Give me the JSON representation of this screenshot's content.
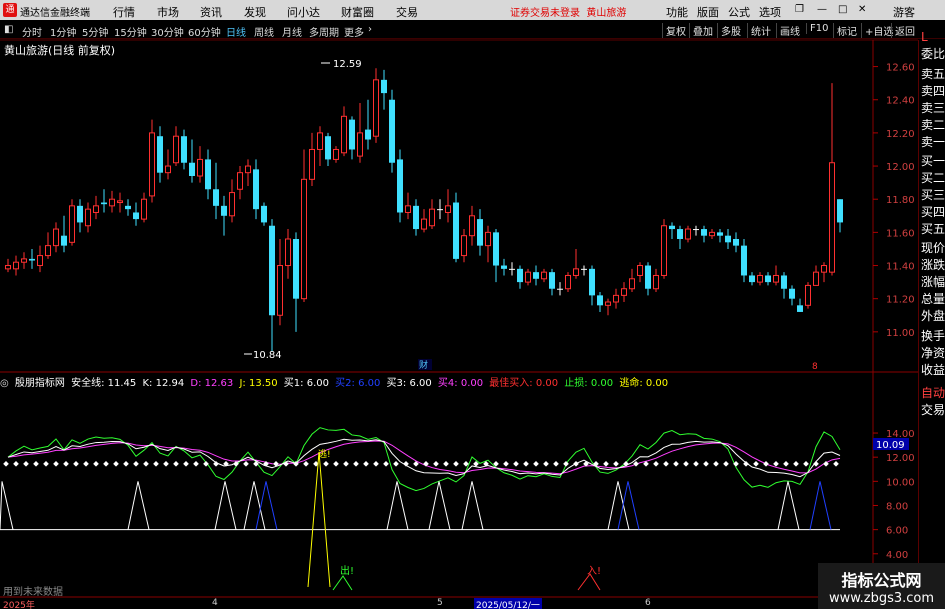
{
  "app": {
    "title": "通达信金融终端",
    "login_notice": "证券交易未登录",
    "login_stock": "黄山旅游",
    "guest": "游客"
  },
  "menu": [
    "行情",
    "市场",
    "资讯",
    "发现",
    "问小达",
    "财富圈",
    "交易"
  ],
  "right_menu": [
    "功能",
    "版面",
    "公式",
    "选项"
  ],
  "periods": [
    "分时",
    "1分钟",
    "5分钟",
    "15分钟",
    "30分钟",
    "60分钟",
    "日线",
    "周线",
    "月线",
    "多周期",
    "更多"
  ],
  "active_period": "日线",
  "toolbar_right": [
    "复权",
    "叠加",
    "多股",
    "统计",
    "画线",
    "F10",
    "标记",
    "+自选",
    "返回"
  ],
  "stock_label": "黄山旅游(日线 前复权)",
  "right_panel": [
    "L",
    "委比",
    "卖五",
    "卖四",
    "卖三",
    "卖二",
    "卖一",
    "买一",
    "买二",
    "买三",
    "买四",
    "买五",
    "现价",
    "涨跌",
    "涨幅",
    "总量",
    "外盘",
    "换手",
    "净资",
    "收益",
    "自动",
    "交易"
  ],
  "price_axis": [
    "12.60",
    "12.40",
    "12.20",
    "12.00",
    "11.80",
    "11.60",
    "11.40",
    "11.20",
    "11.00"
  ],
  "ind_axis": [
    "14.00",
    "12.00",
    "10.00",
    "8.00",
    "6.00",
    "4.00",
    "2.00"
  ],
  "ind_current": "10.09",
  "annotations": {
    "high": "12.59",
    "low": "10.84",
    "cai": "财",
    "num8": "8",
    "tao": "逃!",
    "chu": "出!",
    "ru": "入!"
  },
  "indicator": {
    "name": "殷朋指标网",
    "items": [
      {
        "label": "安全线: 11.45",
        "color": "#ffffff"
      },
      {
        "label": "K: 12.94",
        "color": "#ffffff"
      },
      {
        "label": "D: 12.63",
        "color": "#ff40ff"
      },
      {
        "label": "J: 13.50",
        "color": "#ffff00"
      },
      {
        "label": "买1: 6.00",
        "color": "#ffffff"
      },
      {
        "label": "买2: 6.00",
        "color": "#2040ff"
      },
      {
        "label": "买3: 6.00",
        "color": "#ffffff"
      },
      {
        "label": "买4: 0.00",
        "color": "#ff40ff"
      },
      {
        "label": "最佳买入: 0.00",
        "color": "#ff3030"
      },
      {
        "label": "止损: 0.00",
        "color": "#30ff30"
      },
      {
        "label": "逃命: 0.00",
        "color": "#ffff00"
      }
    ]
  },
  "dates": [
    "2025年",
    "4",
    "5",
    "2025/05/12/一",
    "6"
  ],
  "footer": "用到未来数据",
  "watermark": {
    "line1": "指标公式网",
    "line2": "www.zbgs3.com"
  },
  "chart_data": {
    "type": "candlestick",
    "title": "黄山旅游(日线 前复权)",
    "ylim": [
      10.8,
      12.7
    ],
    "candles": [
      [
        11.38,
        11.4,
        11.36,
        11.44
      ],
      [
        11.38,
        11.42,
        11.34,
        11.46
      ],
      [
        11.42,
        11.44,
        11.38,
        11.48
      ],
      [
        11.44,
        11.43,
        11.38,
        11.5
      ],
      [
        11.4,
        11.46,
        11.36,
        11.52
      ],
      [
        11.46,
        11.52,
        11.44,
        11.6
      ],
      [
        11.52,
        11.62,
        11.48,
        11.66
      ],
      [
        11.58,
        11.52,
        11.48,
        11.7
      ],
      [
        11.54,
        11.76,
        11.52,
        11.8
      ],
      [
        11.76,
        11.66,
        11.6,
        11.8
      ],
      [
        11.64,
        11.74,
        11.6,
        11.78
      ],
      [
        11.72,
        11.76,
        11.68,
        11.82
      ],
      [
        11.78,
        11.77,
        11.72,
        11.86
      ],
      [
        11.76,
        11.8,
        11.72,
        11.85
      ],
      [
        11.78,
        11.79,
        11.72,
        11.84
      ],
      [
        11.76,
        11.74,
        11.7,
        11.8
      ],
      [
        11.72,
        11.68,
        11.64,
        11.78
      ],
      [
        11.68,
        11.8,
        11.66,
        11.84
      ],
      [
        11.82,
        12.2,
        11.78,
        12.28
      ],
      [
        12.18,
        11.96,
        11.9,
        12.24
      ],
      [
        11.96,
        12.0,
        11.92,
        12.1
      ],
      [
        12.02,
        12.18,
        12.0,
        12.24
      ],
      [
        12.18,
        12.02,
        11.98,
        12.22
      ],
      [
        12.02,
        11.94,
        11.9,
        12.16
      ],
      [
        11.94,
        12.04,
        11.9,
        12.12
      ],
      [
        12.04,
        11.86,
        11.8,
        12.1
      ],
      [
        11.86,
        11.76,
        11.68,
        12.02
      ],
      [
        11.76,
        11.7,
        11.58,
        11.82
      ],
      [
        11.7,
        11.84,
        11.66,
        11.92
      ],
      [
        11.86,
        11.96,
        11.8,
        12.0
      ],
      [
        11.96,
        12.0,
        11.88,
        12.04
      ],
      [
        11.98,
        11.74,
        11.68,
        12.04
      ],
      [
        11.76,
        11.66,
        11.64,
        11.78
      ],
      [
        11.64,
        11.1,
        10.88,
        11.68
      ],
      [
        11.1,
        11.4,
        11.04,
        11.56
      ],
      [
        11.4,
        11.56,
        11.32,
        11.62
      ],
      [
        11.56,
        11.2,
        11.0,
        11.6
      ],
      [
        11.2,
        11.92,
        11.18,
        12.1
      ],
      [
        11.92,
        12.1,
        11.88,
        12.2
      ],
      [
        12.1,
        12.2,
        12.0,
        12.24
      ],
      [
        12.18,
        12.04,
        12.0,
        12.2
      ],
      [
        12.04,
        12.1,
        12.02,
        12.12
      ],
      [
        12.08,
        12.3,
        12.06,
        12.36
      ],
      [
        12.28,
        12.1,
        12.04,
        12.3
      ],
      [
        12.06,
        12.2,
        12.02,
        12.38
      ],
      [
        12.22,
        12.16,
        12.1,
        12.4
      ],
      [
        12.18,
        12.52,
        12.14,
        12.59
      ],
      [
        12.52,
        12.44,
        12.34,
        12.58
      ],
      [
        12.4,
        12.02,
        11.96,
        12.46
      ],
      [
        12.04,
        11.72,
        11.66,
        12.1
      ],
      [
        11.72,
        11.76,
        11.68,
        11.84
      ],
      [
        11.76,
        11.62,
        11.58,
        11.8
      ],
      [
        11.62,
        11.68,
        11.6,
        11.74
      ],
      [
        11.64,
        11.74,
        11.62,
        11.8
      ],
      [
        11.74,
        11.74,
        11.68,
        11.8
      ],
      [
        11.72,
        11.76,
        11.66,
        11.86
      ],
      [
        11.78,
        11.44,
        11.42,
        11.84
      ],
      [
        11.46,
        11.58,
        11.42,
        11.62
      ],
      [
        11.58,
        11.7,
        11.52,
        11.76
      ],
      [
        11.68,
        11.52,
        11.46,
        11.74
      ],
      [
        11.52,
        11.6,
        11.42,
        11.64
      ],
      [
        11.6,
        11.4,
        11.3,
        11.62
      ],
      [
        11.4,
        11.38,
        11.34,
        11.44
      ],
      [
        11.38,
        11.38,
        11.34,
        11.42
      ],
      [
        11.38,
        11.3,
        11.26,
        11.4
      ],
      [
        11.3,
        11.36,
        11.28,
        11.38
      ],
      [
        11.36,
        11.32,
        11.28,
        11.4
      ],
      [
        11.32,
        11.36,
        11.3,
        11.38
      ],
      [
        11.36,
        11.26,
        11.22,
        11.38
      ],
      [
        11.26,
        11.26,
        11.22,
        11.3
      ],
      [
        11.26,
        11.34,
        11.24,
        11.36
      ],
      [
        11.34,
        11.38,
        11.32,
        11.5
      ],
      [
        11.38,
        11.38,
        11.34,
        11.4
      ],
      [
        11.38,
        11.22,
        11.16,
        11.4
      ],
      [
        11.22,
        11.16,
        11.12,
        11.24
      ],
      [
        11.16,
        11.18,
        11.1,
        11.2
      ],
      [
        11.18,
        11.22,
        11.14,
        11.26
      ],
      [
        11.22,
        11.26,
        11.18,
        11.3
      ],
      [
        11.26,
        11.32,
        11.24,
        11.38
      ],
      [
        11.34,
        11.4,
        11.3,
        11.42
      ],
      [
        11.4,
        11.26,
        11.22,
        11.42
      ],
      [
        11.26,
        11.34,
        11.24,
        11.38
      ],
      [
        11.34,
        11.64,
        11.32,
        11.68
      ],
      [
        11.64,
        11.62,
        11.56,
        11.66
      ],
      [
        11.62,
        11.56,
        11.5,
        11.64
      ],
      [
        11.56,
        11.62,
        11.54,
        11.64
      ],
      [
        11.62,
        11.62,
        11.58,
        11.64
      ],
      [
        11.62,
        11.58,
        11.54,
        11.64
      ],
      [
        11.58,
        11.6,
        11.56,
        11.62
      ],
      [
        11.6,
        11.58,
        11.54,
        11.62
      ],
      [
        11.58,
        11.54,
        11.5,
        11.62
      ],
      [
        11.56,
        11.52,
        11.48,
        11.6
      ],
      [
        11.52,
        11.34,
        11.3,
        11.56
      ],
      [
        11.34,
        11.3,
        11.28,
        11.36
      ],
      [
        11.3,
        11.34,
        11.28,
        11.36
      ],
      [
        11.34,
        11.3,
        11.28,
        11.36
      ],
      [
        11.3,
        11.34,
        11.28,
        11.4
      ],
      [
        11.34,
        11.26,
        11.2,
        11.36
      ],
      [
        11.26,
        11.2,
        11.16,
        11.28
      ],
      [
        11.16,
        11.12,
        11.12,
        11.2
      ],
      [
        11.16,
        11.28,
        11.14,
        11.3
      ],
      [
        11.28,
        11.36,
        11.28,
        11.4
      ],
      [
        11.36,
        11.4,
        11.3,
        11.42
      ],
      [
        11.36,
        12.02,
        11.34,
        12.5
      ],
      [
        11.8,
        11.66,
        11.6,
        11.8
      ]
    ]
  }
}
